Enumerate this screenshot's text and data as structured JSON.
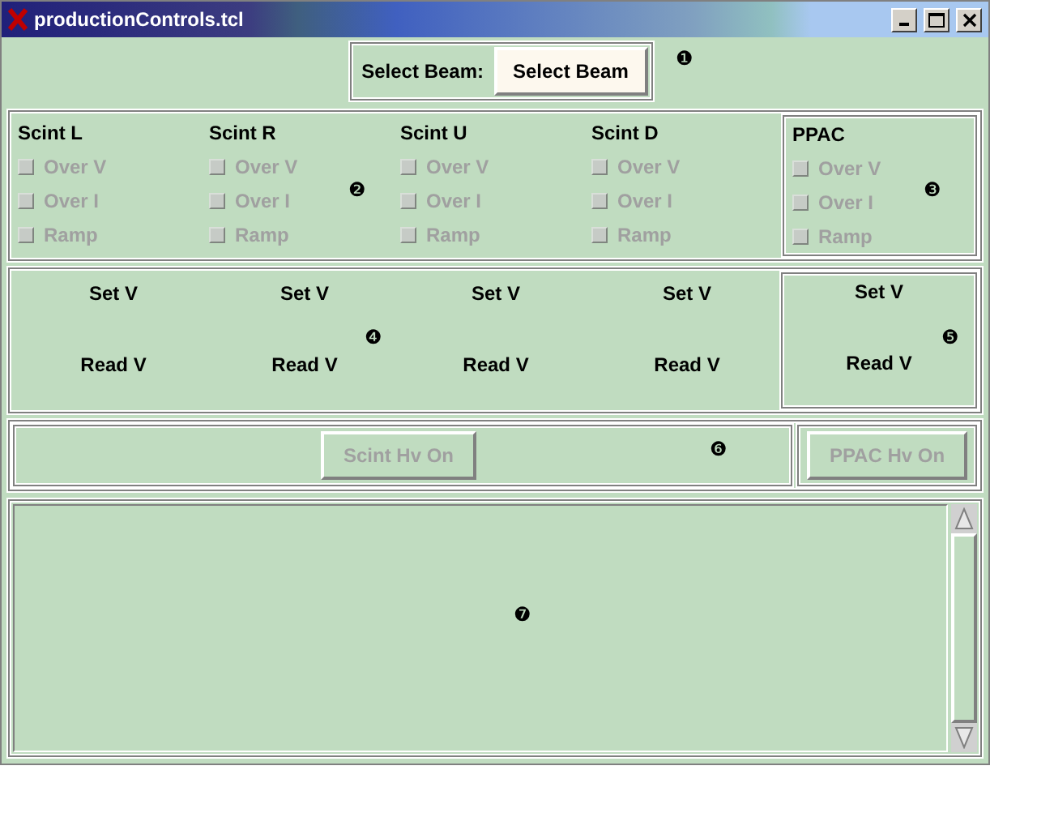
{
  "window": {
    "title": "productionControls.tcl"
  },
  "beam": {
    "label": "Select Beam:",
    "button": "Select Beam",
    "marker": "❶"
  },
  "detectors": {
    "marker": "❷",
    "columns": [
      {
        "name": "Scint L",
        "flags": [
          {
            "label": "Over V",
            "checked": false,
            "disabled": true
          },
          {
            "label": "Over I",
            "checked": false,
            "disabled": true
          },
          {
            "label": "Ramp",
            "checked": false,
            "disabled": true
          }
        ]
      },
      {
        "name": "Scint R",
        "flags": [
          {
            "label": "Over V",
            "checked": false,
            "disabled": true
          },
          {
            "label": "Over I",
            "checked": false,
            "disabled": true
          },
          {
            "label": "Ramp",
            "checked": false,
            "disabled": true
          }
        ]
      },
      {
        "name": "Scint U",
        "flags": [
          {
            "label": "Over V",
            "checked": false,
            "disabled": true
          },
          {
            "label": "Over I",
            "checked": false,
            "disabled": true
          },
          {
            "label": "Ramp",
            "checked": false,
            "disabled": true
          }
        ]
      },
      {
        "name": "Scint D",
        "flags": [
          {
            "label": "Over V",
            "checked": false,
            "disabled": true
          },
          {
            "label": "Over I",
            "checked": false,
            "disabled": true
          },
          {
            "label": "Ramp",
            "checked": false,
            "disabled": true
          }
        ]
      }
    ]
  },
  "ppac": {
    "marker": "❸",
    "name": "PPAC",
    "flags": [
      {
        "label": "Over V",
        "checked": false,
        "disabled": true
      },
      {
        "label": "Over I",
        "checked": false,
        "disabled": true
      },
      {
        "label": "Ramp",
        "checked": false,
        "disabled": true
      }
    ]
  },
  "voltages": {
    "marker": "❹",
    "columns": [
      {
        "set": "Set V",
        "read": "Read V"
      },
      {
        "set": "Set V",
        "read": "Read V"
      },
      {
        "set": "Set V",
        "read": "Read V"
      },
      {
        "set": "Set V",
        "read": "Read V"
      }
    ]
  },
  "ppac_voltages": {
    "marker": "❺",
    "set": "Set V",
    "read": "Read V"
  },
  "hv": {
    "marker": "❻",
    "scint_button": {
      "label": "Scint Hv On",
      "disabled": true
    },
    "ppac_button": {
      "label": "PPAC Hv On",
      "disabled": true
    }
  },
  "log": {
    "marker": "❼"
  }
}
